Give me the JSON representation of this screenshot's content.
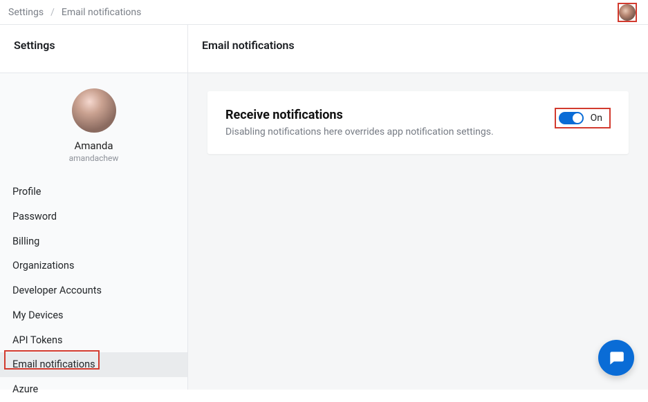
{
  "breadcrumbs": {
    "root": "Settings",
    "current": "Email notifications"
  },
  "sidebar": {
    "title": "Settings",
    "user": {
      "display_name": "Amanda",
      "username": "amandachew"
    },
    "items": [
      {
        "label": "Profile"
      },
      {
        "label": "Password"
      },
      {
        "label": "Billing"
      },
      {
        "label": "Organizations"
      },
      {
        "label": "Developer Accounts"
      },
      {
        "label": "My Devices"
      },
      {
        "label": "API Tokens"
      },
      {
        "label": "Email notifications",
        "active": true
      },
      {
        "label": "Azure"
      }
    ]
  },
  "content": {
    "header": "Email notifications"
  },
  "card": {
    "title": "Receive notifications",
    "description": "Disabling notifications here overrides app notification settings.",
    "toggle_state_label": "On",
    "toggle_on": true
  },
  "icons": {
    "avatar_corner": "user-avatar-icon",
    "user_avatar": "user-avatar-icon",
    "chat": "chat-bubble-icon"
  },
  "colors": {
    "accent": "#0a6cd6",
    "highlight_box": "#d23a2e"
  }
}
